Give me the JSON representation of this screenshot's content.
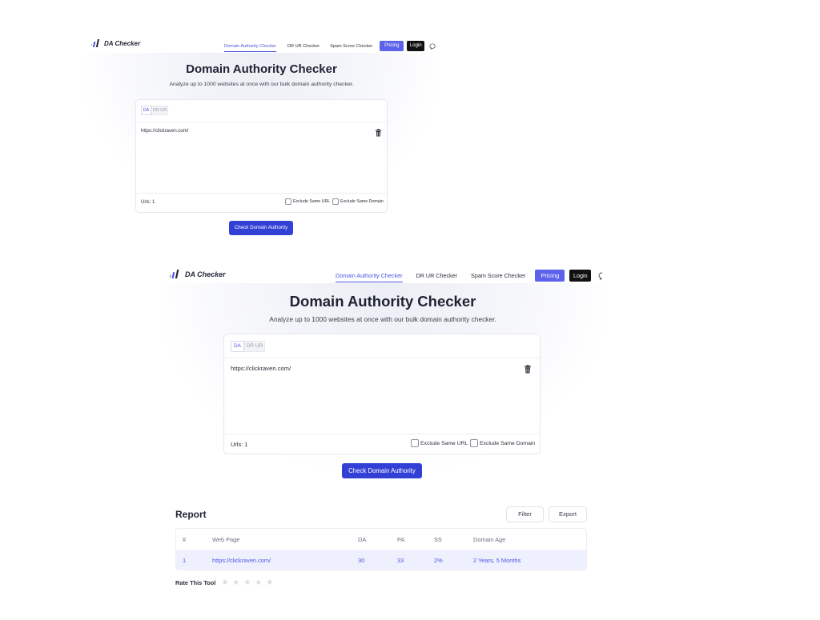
{
  "app": {
    "logo_text": "DA Checker"
  },
  "nav": {
    "links": [
      "Domain Authority Checker",
      "DR UR Checker",
      "Spam Score Checker"
    ],
    "pricing": "Pricing",
    "login": "Login"
  },
  "hero": {
    "title": "Domain Authority Checker",
    "subtitle": "Analyze up to 1000 websites at once with our bulk domain authority checker."
  },
  "checker": {
    "tabs": [
      "DA",
      "DR UR"
    ],
    "url_value": "https://clickraven.com/",
    "urls_count": "Urls: 1",
    "exclude_same_url": "Exclude Same URL",
    "exclude_same_domain": "Exclude Same Domain",
    "submit": "Check Domain Authority"
  },
  "report": {
    "title": "Report",
    "filter": "Filter",
    "export": "Export",
    "columns": [
      "#",
      "Web Page",
      "DA",
      "PA",
      "SS",
      "Domain Age"
    ],
    "rows": [
      [
        "1",
        "https://clickraven.com/",
        "30",
        "33",
        "2%",
        "2 Years, 5 Months"
      ]
    ]
  },
  "rating": {
    "label": "Rate This Tool",
    "stars": 5,
    "filled": 0
  },
  "colors": {
    "accent": "#4a55e0",
    "primary_button": "#3340d6",
    "pricing": "#5c62ea",
    "login": "#111111"
  },
  "icons": {
    "logo": "bar-chart-logo-icon",
    "trash": "trash-icon",
    "chat": "chat-bubble-icon",
    "star": "star-icon"
  }
}
